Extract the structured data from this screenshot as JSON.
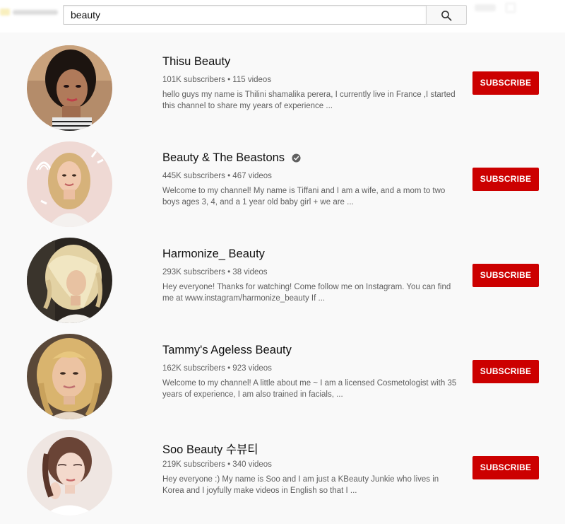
{
  "search": {
    "query": "beauty",
    "button_icon": "search-icon"
  },
  "colors": {
    "subscribe_bg": "#cc0000",
    "page_bg": "#f9f9f9",
    "title": "#0f0f0f",
    "meta": "#606060"
  },
  "results": [
    {
      "name": "Thisu Beauty",
      "verified": false,
      "subscribers": "101K subscribers",
      "videos": "115 videos",
      "description": "hello guys my name is Thilini shamalika perera, I currently live in France ,I started this channel to share my years of experience ...",
      "subscribe_label": "SUBSCRIBE",
      "avatar_icon": "channel-avatar"
    },
    {
      "name": "Beauty & The Beastons",
      "verified": true,
      "subscribers": "445K subscribers",
      "videos": "467 videos",
      "description": "Welcome to my channel! My name is Tiffani and I am a wife, and a mom to two boys ages 3, 4, and a 1 year old baby girl + we are ...",
      "subscribe_label": "SUBSCRIBE",
      "avatar_icon": "channel-avatar"
    },
    {
      "name": "Harmonize_ Beauty",
      "verified": false,
      "subscribers": "293K subscribers",
      "videos": "38 videos",
      "description": "Hey everyone! Thanks for watching! Come follow me on Instagram. You can find me at www.instagram/harmonize_beauty If ...",
      "subscribe_label": "SUBSCRIBE",
      "avatar_icon": "channel-avatar"
    },
    {
      "name": "Tammy's Ageless Beauty",
      "verified": false,
      "subscribers": "162K subscribers",
      "videos": "923 videos",
      "description": "Welcome to my channel! A little about me ~ I am a licensed Cosmetologist with 35 years of experience, I am also trained in facials, ...",
      "subscribe_label": "SUBSCRIBE",
      "avatar_icon": "channel-avatar"
    },
    {
      "name": "Soo Beauty 수뷰티",
      "verified": false,
      "subscribers": "219K subscribers",
      "videos": "340 videos",
      "description": "Hey everyone :) My name is Soo and I am just a KBeauty Junkie who lives in Korea and I joyfully make videos in English so that I ...",
      "subscribe_label": "SUBSCRIBE",
      "avatar_icon": "channel-avatar"
    }
  ]
}
